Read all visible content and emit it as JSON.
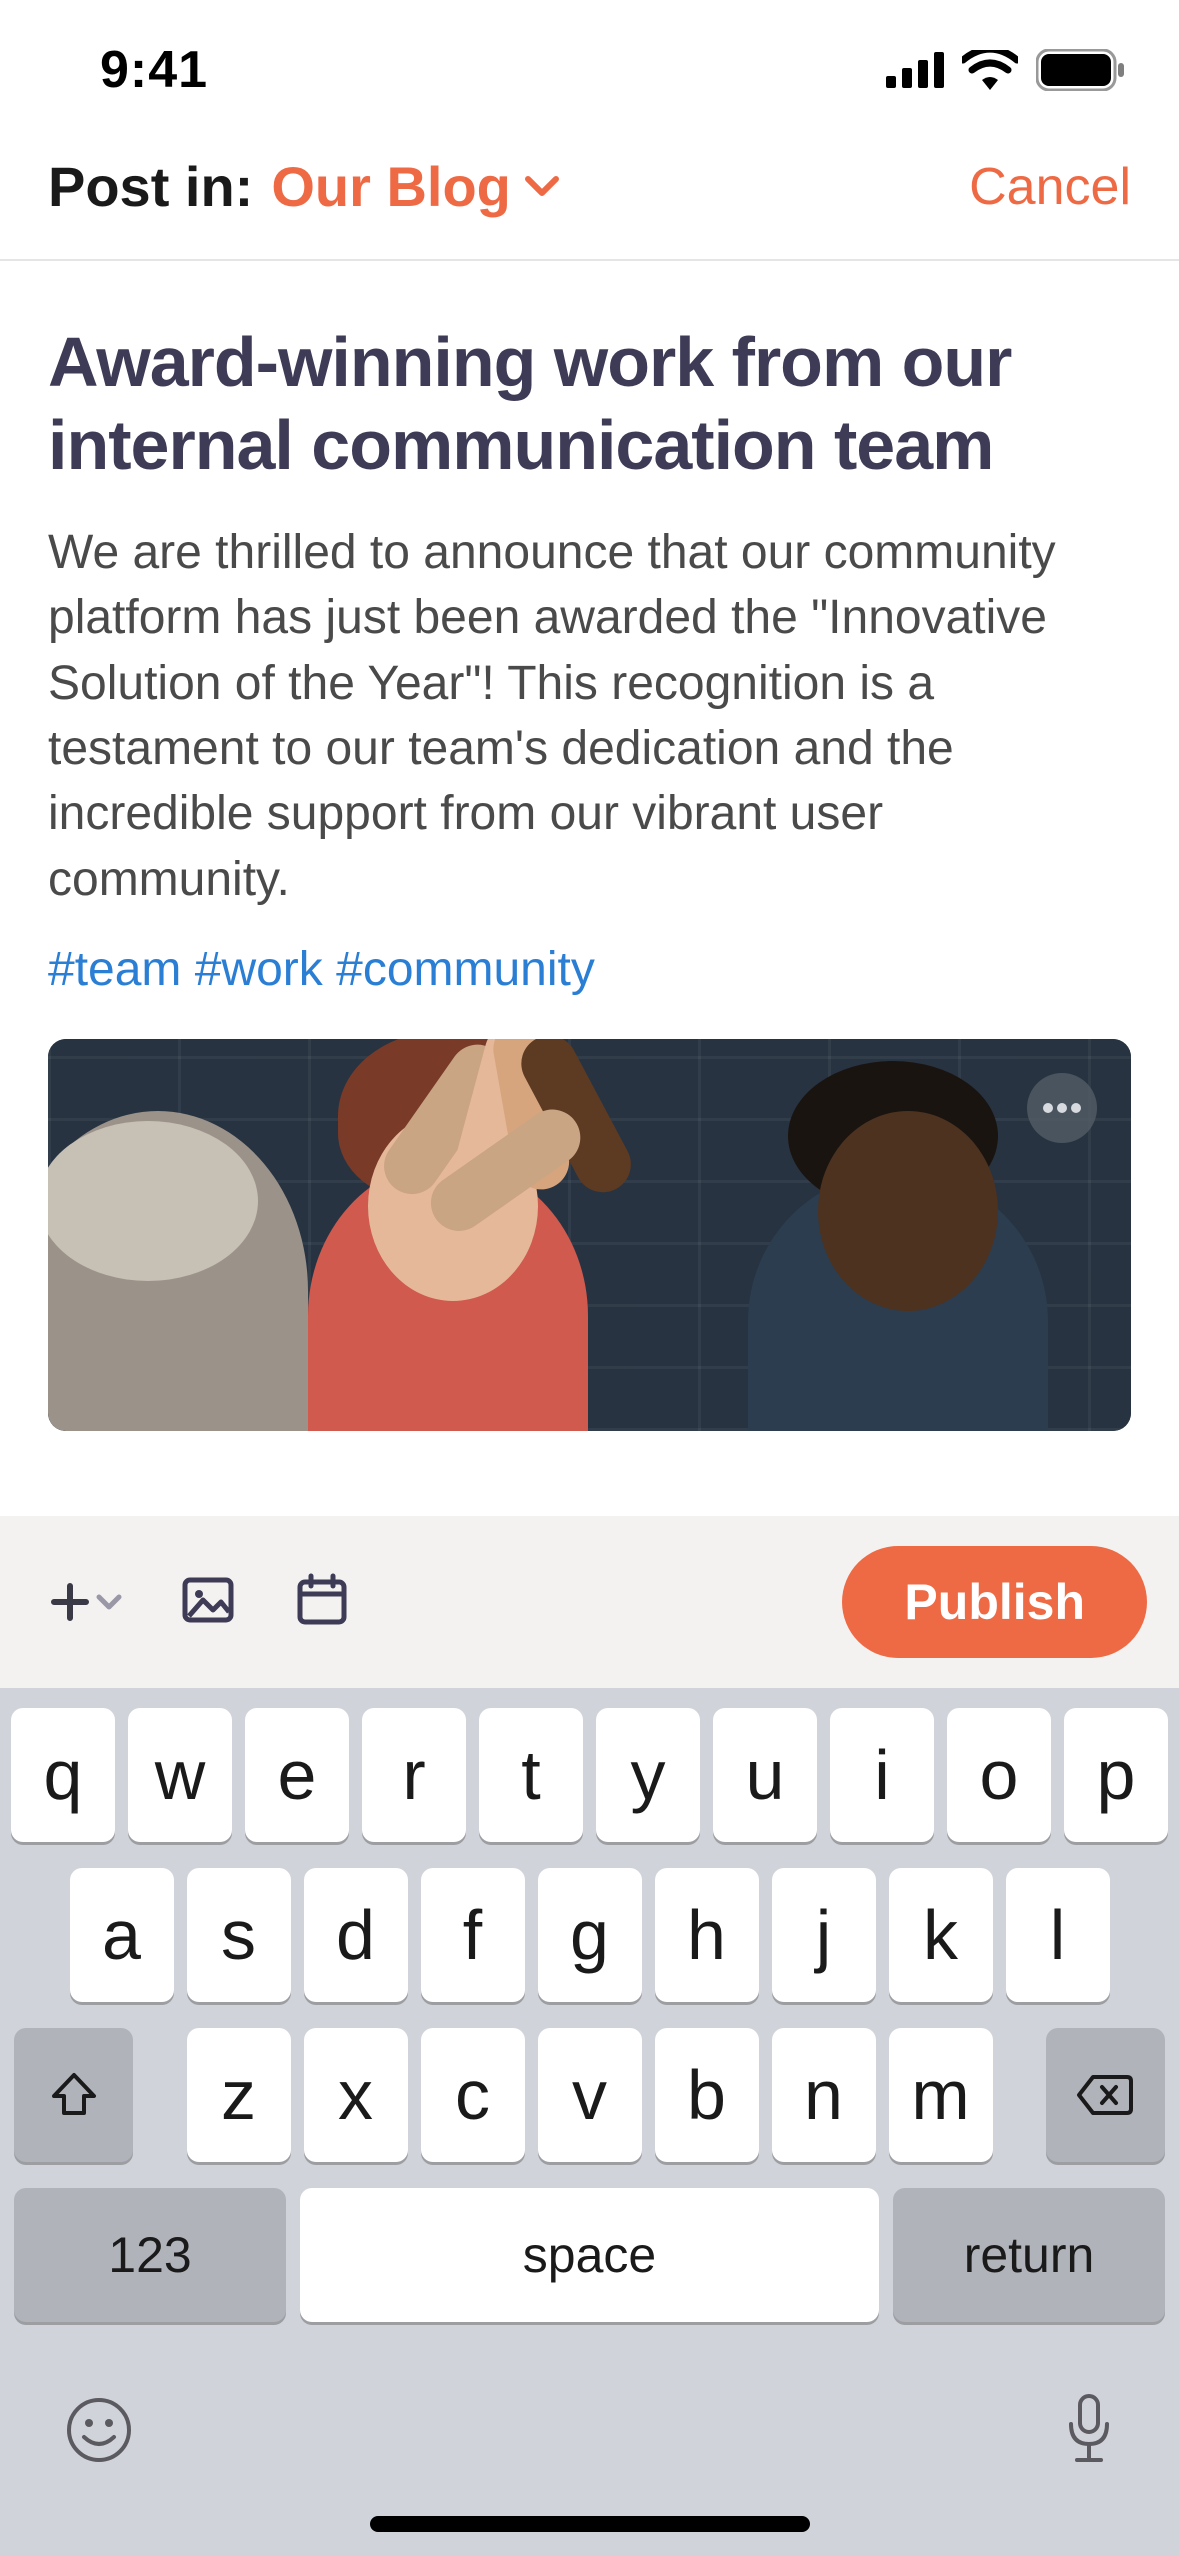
{
  "status": {
    "time": "9:41"
  },
  "header": {
    "post_in_label": "Post in:",
    "blog_name": "Our Blog",
    "cancel": "Cancel"
  },
  "post": {
    "title": "Award-winning work from our internal communication team",
    "body": "We are thrilled to announce that our community platform has just been awarded the \"Innovative Solution of the Year\"! This recognition is a testament to our team's dedication and the incredible support from our vibrant user community.",
    "tags": "#team #work #community"
  },
  "toolbar": {
    "publish": "Publish"
  },
  "keyboard": {
    "row1": [
      "q",
      "w",
      "e",
      "r",
      "t",
      "y",
      "u",
      "i",
      "o",
      "p"
    ],
    "row2": [
      "a",
      "s",
      "d",
      "f",
      "g",
      "h",
      "j",
      "k",
      "l"
    ],
    "row3": [
      "z",
      "x",
      "c",
      "v",
      "b",
      "n",
      "m"
    ],
    "numbers": "123",
    "space": "space",
    "return": "return"
  }
}
